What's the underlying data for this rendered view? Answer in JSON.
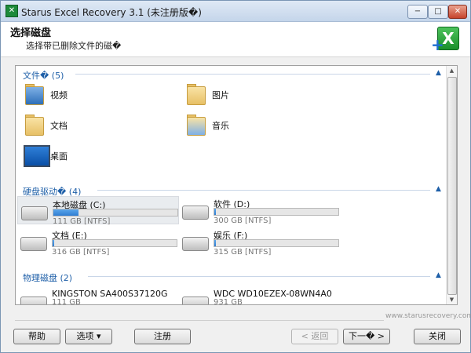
{
  "window": {
    "title": "Starus Excel Recovery 3.1 (未注册版�)",
    "minimize": "−",
    "maximize": "□",
    "close": "✕"
  },
  "header": {
    "title": "选择磁盘",
    "subtitle": "选择带已删除文件的磁�",
    "logo_letter": "X",
    "logo_plus": "+"
  },
  "groups": {
    "folders": {
      "label": "文件� (5)",
      "collapse": "▲"
    },
    "drives": {
      "label": "硬盘驱动� (4)",
      "collapse": "▲"
    },
    "physical": {
      "label": "物理磁盘 (2)",
      "collapse": "▲"
    }
  },
  "folders": [
    {
      "label": "视频",
      "icon": "video-folder-icon"
    },
    {
      "label": "图片",
      "icon": "pictures-folder-icon"
    },
    {
      "label": "文档",
      "icon": "documents-folder-icon"
    },
    {
      "label": "音乐",
      "icon": "music-folder-icon"
    },
    {
      "label": "桌面",
      "icon": "desktop-icon"
    }
  ],
  "drives": [
    {
      "name": "本地磁盘 (C:)",
      "info": "111 GB [NTFS]",
      "used": 0.2
    },
    {
      "name": "软件 (D:)",
      "info": "300 GB [NTFS]",
      "used": 0.01
    },
    {
      "name": "文档 (E:)",
      "info": "316 GB [NTFS]",
      "used": 0.01
    },
    {
      "name": "娱乐 (F:)",
      "info": "315 GB [NTFS]",
      "used": 0.01
    }
  ],
  "physical": [
    {
      "name": "KINGSTON SA400S37120G",
      "info": "111 GB"
    },
    {
      "name": "WDC WD10EZEX-08WN4A0",
      "info": "931 GB"
    }
  ],
  "footer": {
    "url": "www.starusrecovery.com",
    "help": "帮助",
    "options": "选项 ▾",
    "register": "注册",
    "back": "< 返回",
    "next": "下一� >",
    "close": "关闭"
  },
  "colors": {
    "accent": "#1e5fa8",
    "progress": "#2f7ed2",
    "close_button": "#c6432c"
  }
}
